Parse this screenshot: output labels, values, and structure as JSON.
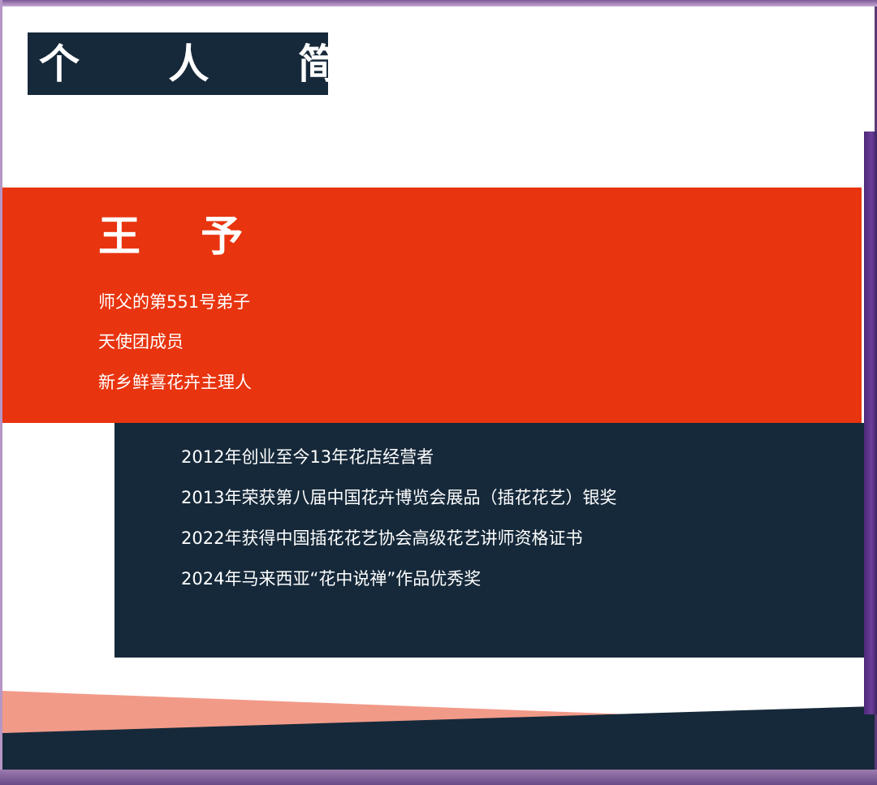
{
  "header": {
    "title": "个 人 简 介"
  },
  "profile": {
    "name": "王 予",
    "roles": [
      "师父的第551号弟子",
      "天使团成员",
      "新乡鲜喜花卉主理人"
    ]
  },
  "achievements": [
    "2012年创业至今13年花店经营者",
    "2013年荣获第八届中国花卉博览会展品（插花花艺）银奖",
    "2022年获得中国插花花艺协会高级花艺讲师资格证书",
    "2024年马来西亚“花中说禅”作品优秀奖"
  ],
  "colors": {
    "navy": "#16293a",
    "red": "#e8340f",
    "salmon": "#f29a88",
    "frame_purple": "#5a3a78"
  }
}
